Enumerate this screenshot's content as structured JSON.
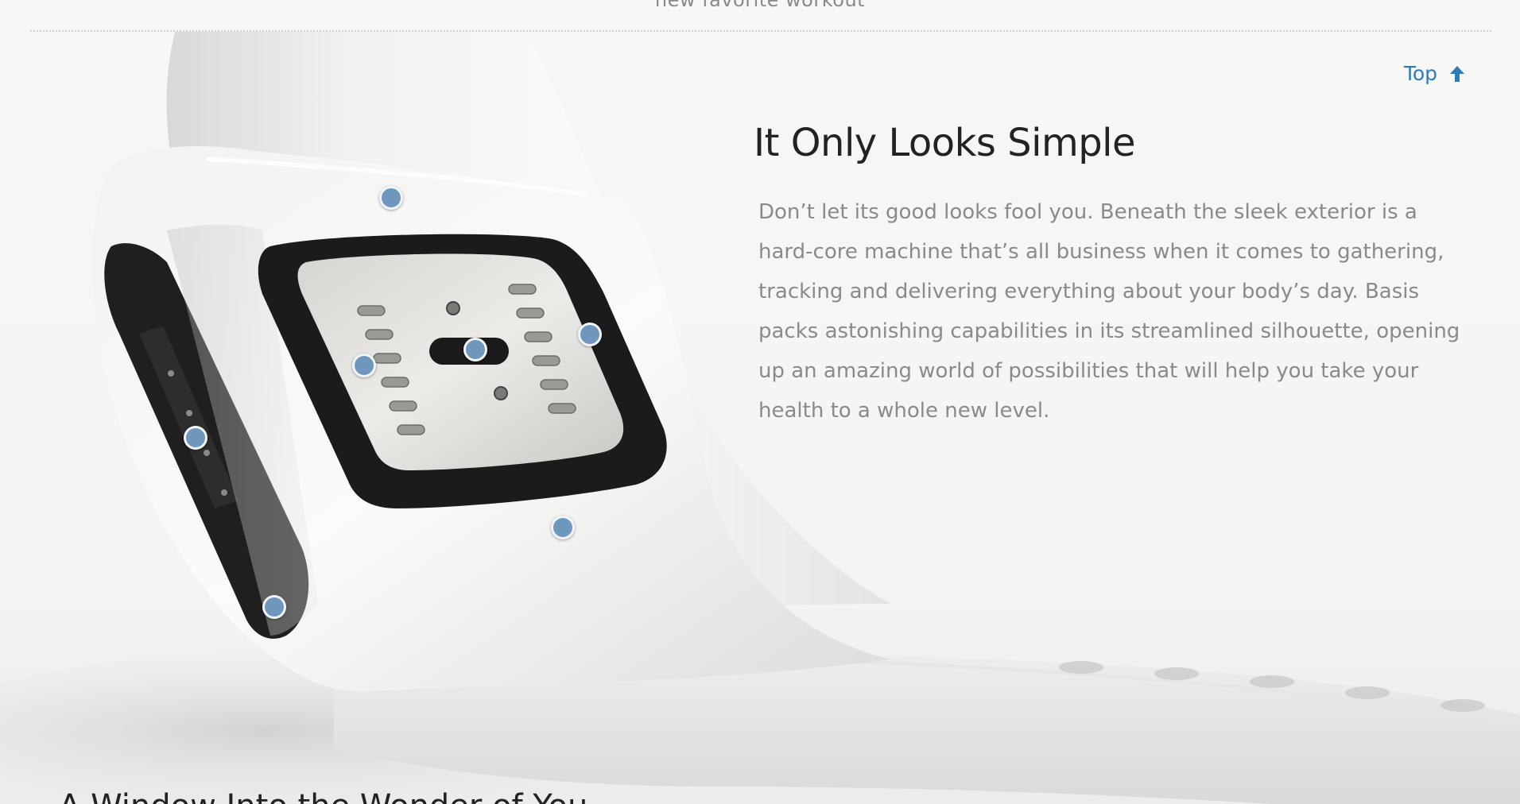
{
  "page": {
    "top_caption": "new favorite workout"
  },
  "nav": {
    "top_label": "Top",
    "top_icon": "arrow-up-icon",
    "accent_color": "#2e7bb6"
  },
  "feature": {
    "heading": "It Only Looks Simple",
    "body": "Don’t let its good looks fool you. Beneath the sleek exterior is a hard-core machine that’s all business when it comes to gathering, tracking and delivering everything about your body’s day. Basis packs astonishing capabilities in its streamlined silhouette, opening up an amazing world of possibilities that will help you take your health to a whole new level."
  },
  "next_section": {
    "heading": "A Window Into the Wonder of You"
  },
  "hotspots": {
    "color": "#6f97bd",
    "count": 7
  }
}
